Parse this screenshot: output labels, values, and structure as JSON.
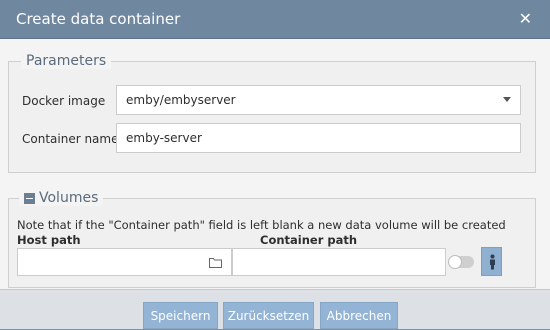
{
  "dialog": {
    "title": "Create data container",
    "close_icon": "close-icon"
  },
  "parameters": {
    "legend": "Parameters",
    "docker_image": {
      "label": "Docker image",
      "value": "emby/embyserver"
    },
    "container_name": {
      "label": "Container name",
      "value": "emby-server"
    }
  },
  "volumes": {
    "legend": "Volumes",
    "collapse_icon": "minus-square-icon",
    "note": "Note that if the \"Container path\" field is left blank a new data volume will be created",
    "host_path_header": "Host path",
    "container_path_header": "Container path",
    "host_path_value": "",
    "container_path_value": "",
    "folder_icon": "folder-icon",
    "readonly_toggle_on": false,
    "person_icon": "person-icon"
  },
  "footer": {
    "save_label": "Speichern",
    "reset_label": "Zurücksetzen",
    "cancel_label": "Abbrechen"
  }
}
